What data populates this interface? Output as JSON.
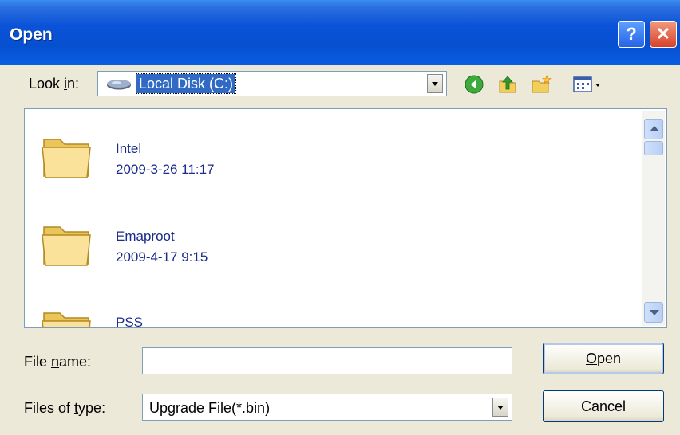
{
  "window": {
    "title": "Open",
    "help_glyph": "?",
    "close_glyph": "✕"
  },
  "toolbar": {
    "look_in_label_pre": "Look ",
    "look_in_label_mnemonic": "i",
    "look_in_label_post": "n:",
    "look_in_value": "Local Disk (C:)",
    "icons": [
      "drive-icon",
      "back-icon",
      "up-folder-icon",
      "new-folder-icon",
      "views-menu-icon"
    ]
  },
  "files": [
    {
      "name": "Intel",
      "date": "2009-3-26 11:17"
    },
    {
      "name": "Emaproot",
      "date": "2009-4-17 9:15"
    },
    {
      "name": "PSS",
      "date": ""
    }
  ],
  "fields": {
    "file_name_label_pre": "File ",
    "file_name_label_mnemonic": "n",
    "file_name_label_post": "ame:",
    "file_name_value": "",
    "file_type_label_pre": "Files of ",
    "file_type_label_mnemonic": "t",
    "file_type_label_post": "ype:",
    "file_type_value": "Upgrade File(*.bin)"
  },
  "buttons": {
    "open_mnemonic": "O",
    "open_rest": "pen",
    "cancel_label": "Cancel"
  },
  "colors": {
    "title_bar": "#0a52d8",
    "selection": "#316ac5",
    "dialog_bg": "#ece9d8",
    "file_text": "#1a2b8c"
  }
}
